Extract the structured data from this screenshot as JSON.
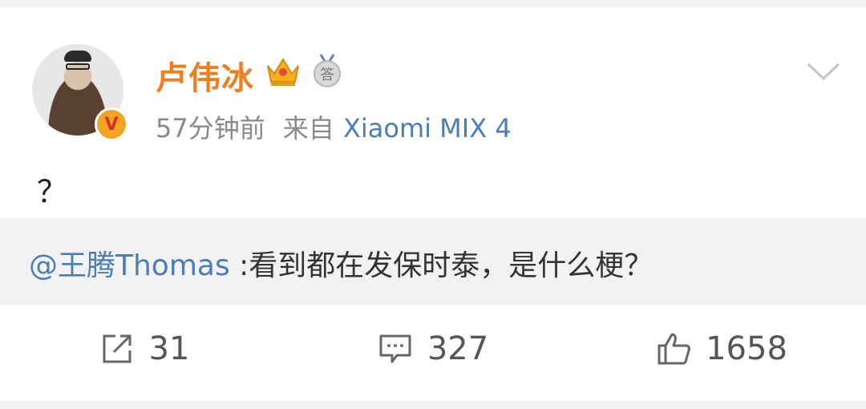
{
  "post": {
    "author": "卢伟冰",
    "time": "57分钟前",
    "source_prefix": "来自",
    "source": "Xiaomi MIX 4",
    "text": "？",
    "badges": [
      "crown-icon",
      "answer-icon"
    ],
    "verified_badge": "V",
    "answer_badge_text": "答"
  },
  "repost": {
    "mention": "@王腾Thomas",
    "text": " :看到都在发保时泰，是什么梗？"
  },
  "actions": {
    "share_count": "31",
    "comment_count": "327",
    "like_count": "1658"
  },
  "colors": {
    "username": "#ec7f1f",
    "link": "#4b7db6",
    "meta": "#8a8a8a",
    "background": "#f2f2f2"
  }
}
